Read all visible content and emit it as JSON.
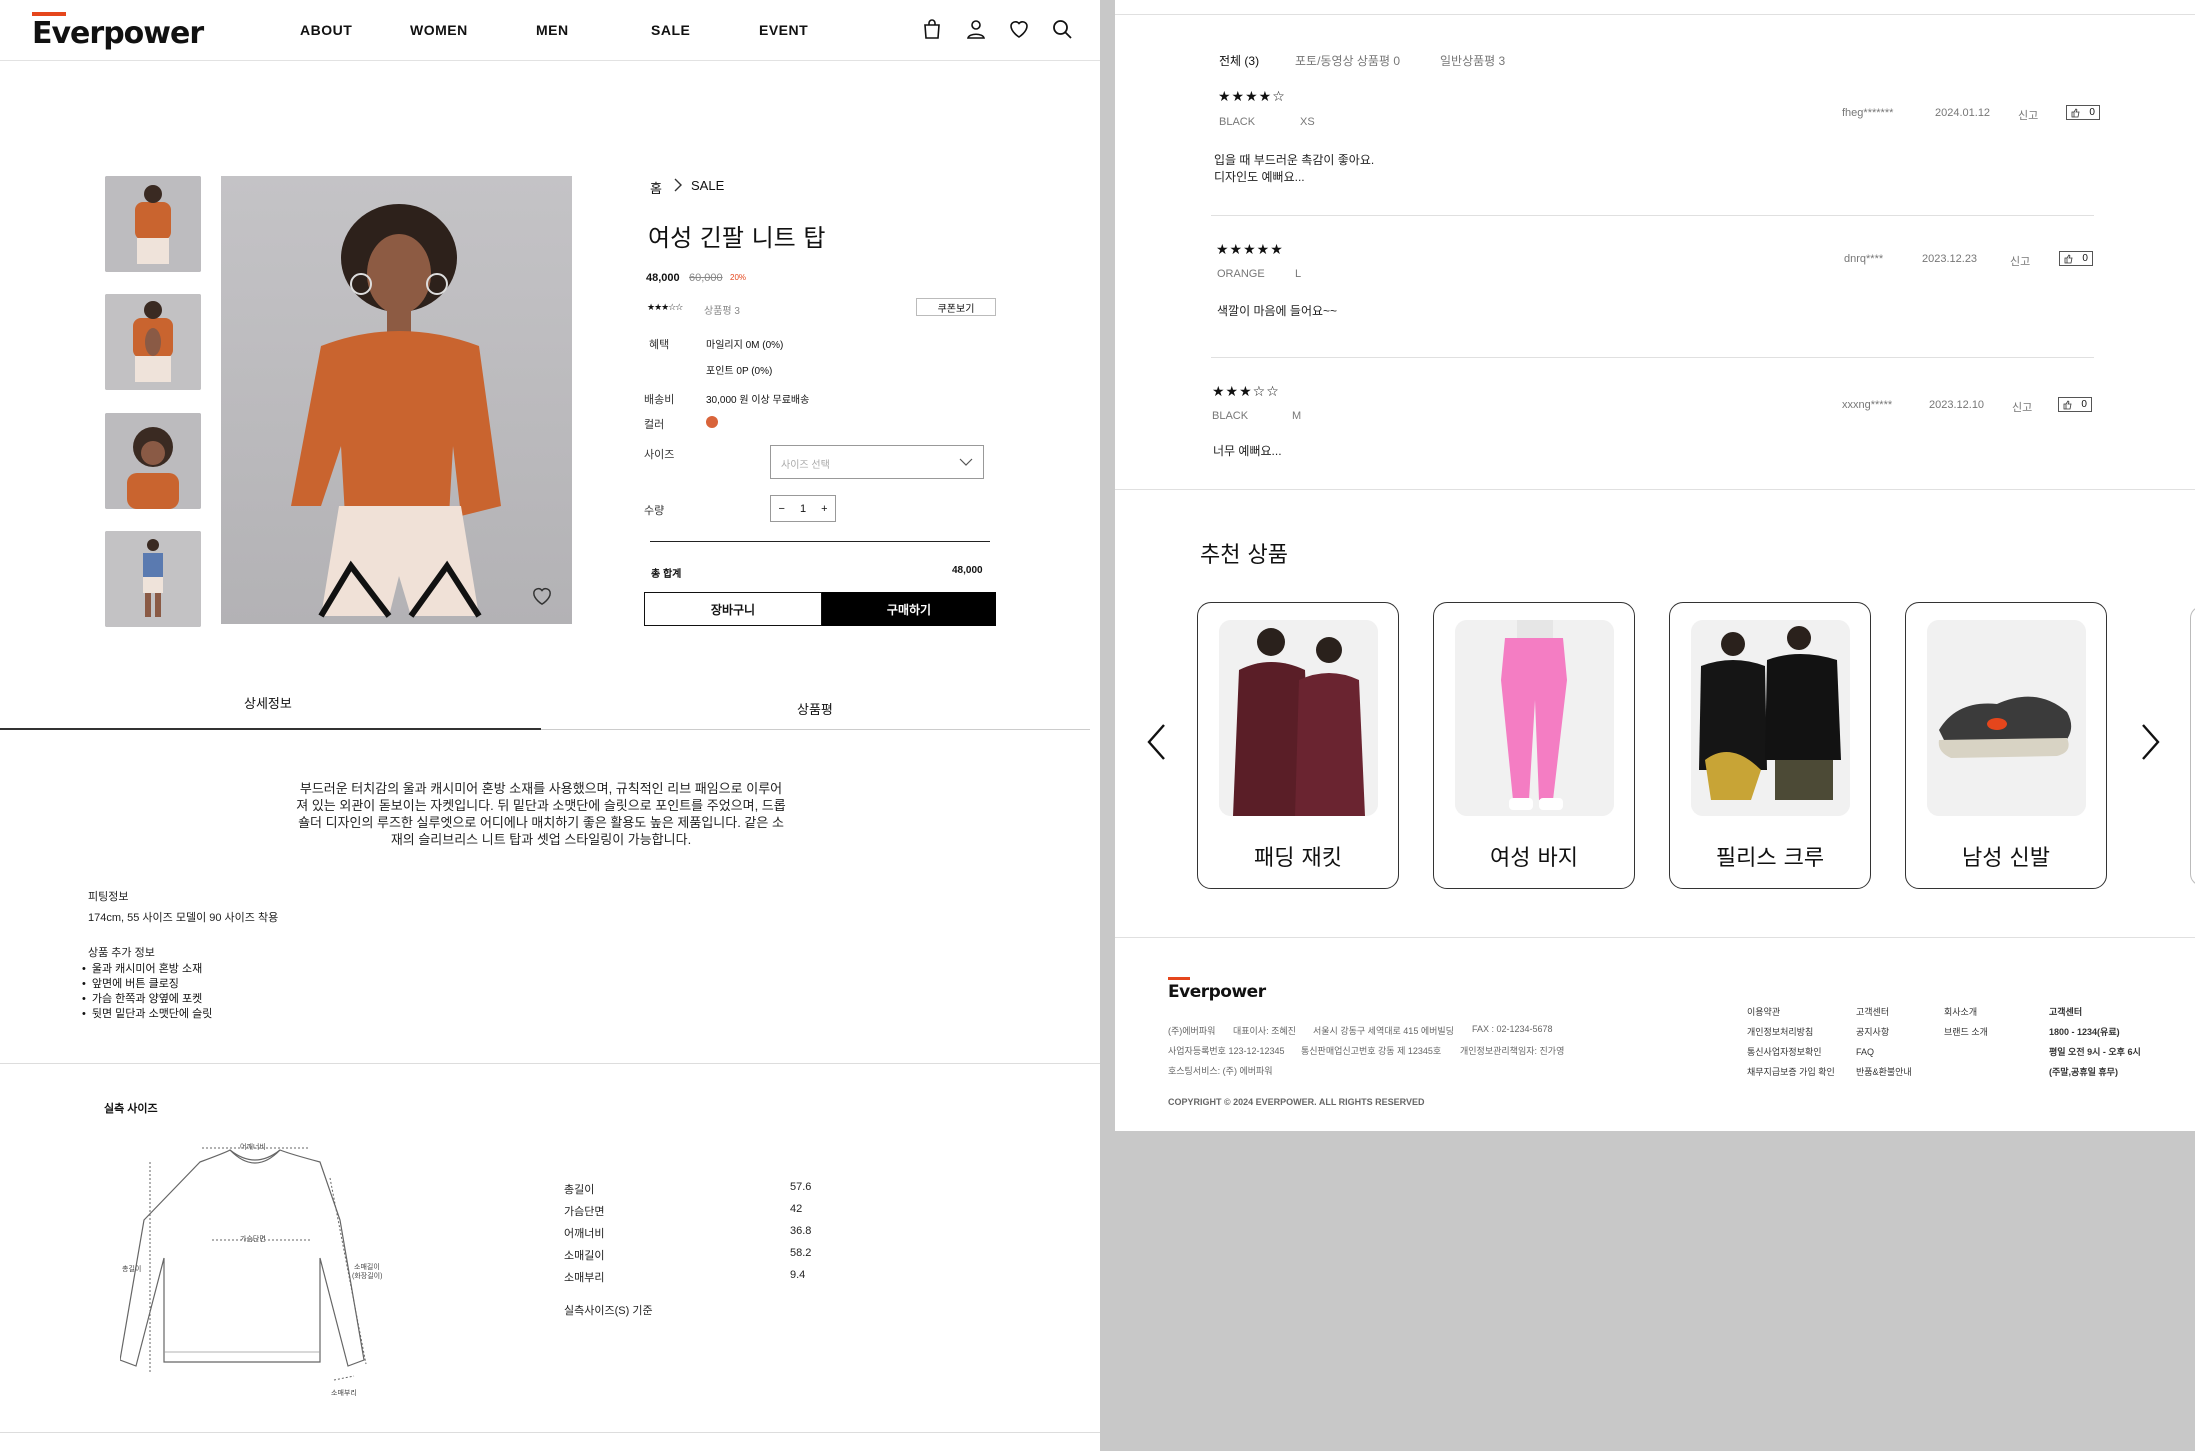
{
  "header": {
    "logo": "Everpower",
    "nav": [
      "ABOUT",
      "WOMEN",
      "MEN",
      "SALE",
      "EVENT"
    ]
  },
  "product": {
    "breadcrumb_home": "홈",
    "breadcrumb_current": "SALE",
    "title": "여성 긴팔 니트 탑",
    "price": "48,000",
    "original_price": "60,000",
    "discount": "20%",
    "rating_stars": "★★★☆☆",
    "review_label": "상품평 3",
    "coupon_button": "쿠폰보기",
    "benefit_label": "혜택",
    "benefit_mileage": "마일리지 0M (0%)",
    "benefit_point": "포인트 0P (0%)",
    "shipping_label": "배송비",
    "shipping_value": "30,000 원 이상 무료배송",
    "color_label": "컬러",
    "color_swatch": "#d9643a",
    "size_label": "사이즈",
    "size_placeholder": "사이즈 선택",
    "qty_label": "수량",
    "qty_value": "1",
    "qty_minus": "−",
    "qty_plus": "+",
    "total_label": "총 합계",
    "total_value": "48,000",
    "cart_button": "장바구니",
    "buy_button": "구매하기"
  },
  "tabs": [
    "상세정보",
    "상품평"
  ],
  "detail": {
    "description": "부드러운 터치감의 울과 캐시미어 혼방 소재를 사용했으며, 규칙적인 리브 패임으로 이루어져 있는 외관이 돋보이는 자켓입니다. 뒤 밑단과 소맷단에 슬릿으로 포인트를 주었으며, 드롭숄더 디자인의 루즈한 실루엣으로 어디에나 매치하기 좋은 활용도 높은 제품입니다. 같은 소재의 슬리브리스 니트 탑과 셋업 스타일링이 가능합니다.",
    "fit_title": "피팅정보",
    "fit_value": "174cm, 55 사이즈 모델이 90 사이즈 착용",
    "extra_title": "상품 추가 정보",
    "extra_items": [
      "울과 캐시미어 혼방 소재",
      "앞면에 버튼 클로징",
      "가슴 한쪽과 양옆에 포켓",
      "뒷면 밑단과 소맷단에 슬릿"
    ]
  },
  "size_chart": {
    "title": "실측 사이즈",
    "diagram_labels": {
      "shoulder": "어깨너비",
      "chest": "가슴단면",
      "length": "총길이",
      "sleeve": "소매길이",
      "sleeve_sub": "(화장길이)",
      "cuff": "소매부리"
    },
    "rows": [
      {
        "label": "총길이",
        "value": "57.6"
      },
      {
        "label": "가슴단면",
        "value": "42"
      },
      {
        "label": "어깨너비",
        "value": "36.8"
      },
      {
        "label": "소매길이",
        "value": "58.2"
      },
      {
        "label": "소매부리",
        "value": "9.4"
      }
    ],
    "note": "실측사이즈(S) 기준"
  },
  "reviews": {
    "tabs": [
      "전체 (3)",
      "포토/동영상 상품평 0",
      "일반상품평 3"
    ],
    "report_label": "신고",
    "items": [
      {
        "stars": "★★★★☆",
        "color": "BLACK",
        "size": "XS",
        "user": "fheg*******",
        "date": "2024.01.12",
        "likes": "0",
        "text": [
          "입을 때 부드러운 촉감이 좋아요.",
          "디자인도 예뻐요..."
        ]
      },
      {
        "stars": "★★★★★",
        "color": "ORANGE",
        "size": "L",
        "user": "dnrq****",
        "date": "2023.12.23",
        "likes": "0",
        "text": [
          "색깔이 마음에 들어요~~"
        ]
      },
      {
        "stars": "★★★☆☆",
        "color": "BLACK",
        "size": "M",
        "user": "xxxng*****",
        "date": "2023.12.10",
        "likes": "0",
        "text": [
          "너무 예뻐요..."
        ]
      }
    ]
  },
  "recommend": {
    "title": "추천 상품",
    "items": [
      "패딩 재킷",
      "여성 바지",
      "필리스 크루",
      "남성 신발"
    ]
  },
  "footer": {
    "logo": "Everpower",
    "company": "(주)에버파워",
    "ceo": "대표이사: 조혜진",
    "address": "서울시 강동구 세역대로 415 에버빌딩",
    "fax": "FAX : 02-1234-5678",
    "biz_no": "사업자등록번호 123-12-12345",
    "mail_order": "통신판매업신고번호 강동 제 12345호",
    "privacy_officer": "개인정보관리책임자: 진가영",
    "hosting": "호스팅서비스: (주) 에버파워",
    "copyright": "COPYRIGHT © 2024 EVERPOWER. ALL RIGHTS RESERVED",
    "col1": [
      "이용약관",
      "개인정보처리방침",
      "통신사업자정보확인",
      "채무지급보증 가입 확인"
    ],
    "col2": [
      "고객센터",
      "공지사항",
      "FAQ",
      "반품&환불안내"
    ],
    "col3": [
      "회사소개",
      "브랜드 소개"
    ],
    "col4": [
      "고객센터",
      "1800 - 1234(유료)",
      "평일 오전 9시 - 오후 6시",
      "(주말,공휴일 휴무)"
    ]
  }
}
